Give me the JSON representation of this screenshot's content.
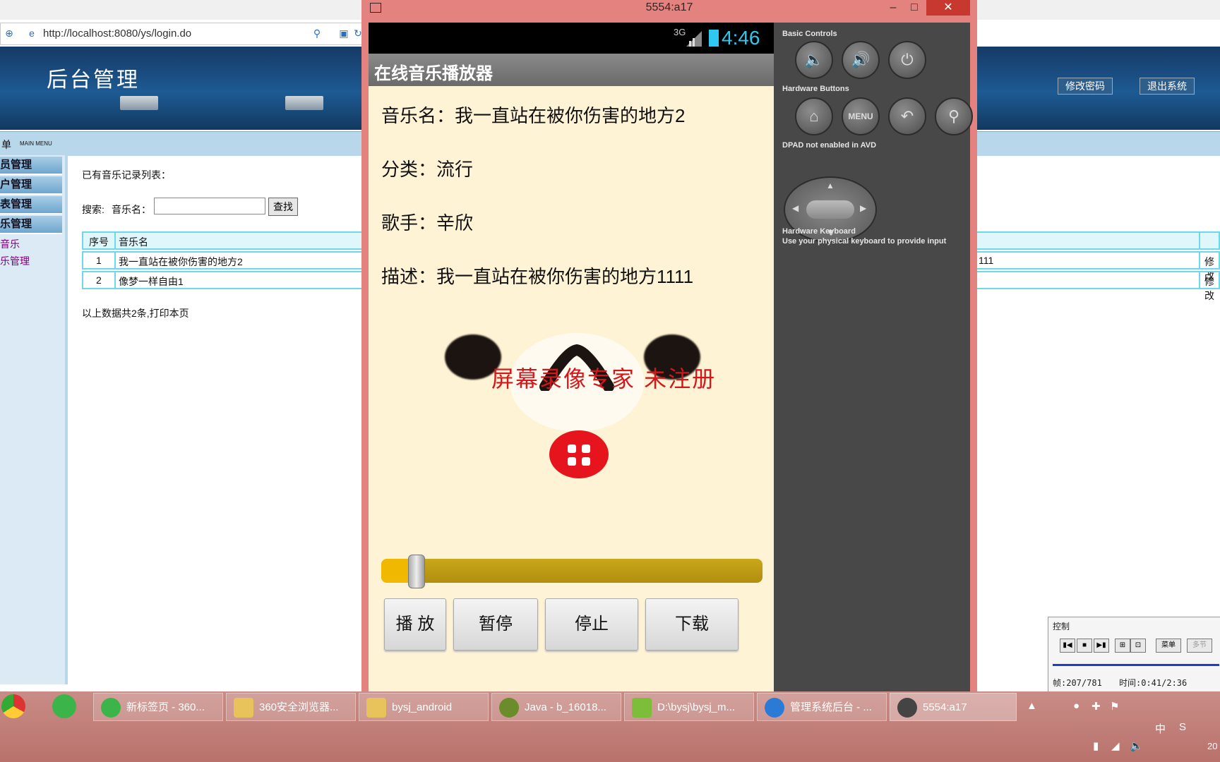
{
  "browser": {
    "url": "http://localhost:8080/ys/login.do",
    "banner_title": "后台管理",
    "change_password": "修改密码",
    "logout": "退出系统",
    "menu_label": "单",
    "menu_label_en": "MAIN MENU",
    "sidebar": [
      "员管理",
      "户管理",
      "表管理",
      "乐管理"
    ],
    "sidebar_links": [
      "音乐",
      "乐管理"
    ],
    "list_title": "已有音乐记录列表：",
    "search_label": "搜索:",
    "search_field_label": "音乐名：",
    "search_value": "",
    "search_button": "查找",
    "table": {
      "headers": [
        "序号",
        "音乐名"
      ],
      "rows": [
        {
          "no": "1",
          "name": "我一直站在被你伤害的地方2",
          "desc_tail": "111",
          "action": "修改"
        },
        {
          "no": "2",
          "name": "像梦一样自由1",
          "desc_tail": "",
          "action": "修改"
        }
      ]
    },
    "footer": "以上数据共2条,打印本页"
  },
  "emulator": {
    "window_title": "5554:a17",
    "status": {
      "network": "3G",
      "time": "4:46"
    },
    "app_title": "在线音乐播放器",
    "music_name": "音乐名：我一直站在被你伤害的地方2",
    "category": "分类：流行",
    "singer": "歌手：辛欣",
    "description": "描述：我一直站在被你伤害的地方1111",
    "watermark": "屏幕录像专家  未注册",
    "progress_fraction": 0.07,
    "buttons": {
      "play": "播 放",
      "pause": "暂停",
      "stop": "停止",
      "download": "下载"
    },
    "panel": {
      "basic_controls": "Basic Controls",
      "hardware_buttons": "Hardware Buttons",
      "dpad_note": "DPAD not enabled in AVD",
      "keyboard_title": "Hardware Keyboard",
      "keyboard_note": "Use your physical keyboard to provide input",
      "menu_label": "MENU"
    }
  },
  "recorder": {
    "title": "控制",
    "menu": "菜单",
    "extra": "多节",
    "frames": "帧:207/781",
    "time": "时间:0:41/2:36"
  },
  "taskbar": {
    "items": [
      "新标签页 - 360...",
      "360安全浏览器...",
      "bysj_android",
      "Java - b_16018...",
      "D:\\bysj\\bysj_m...",
      "管理系统后台 - ...",
      "5554:a17"
    ],
    "ime": "中",
    "clock": "20"
  },
  "colors": {
    "emulator_frame": "#e4827f",
    "screen_bg": "#fff3d6",
    "watermark": "#d6161b",
    "seekbar": "#f0b800",
    "status_time": "#2ec8f0"
  }
}
